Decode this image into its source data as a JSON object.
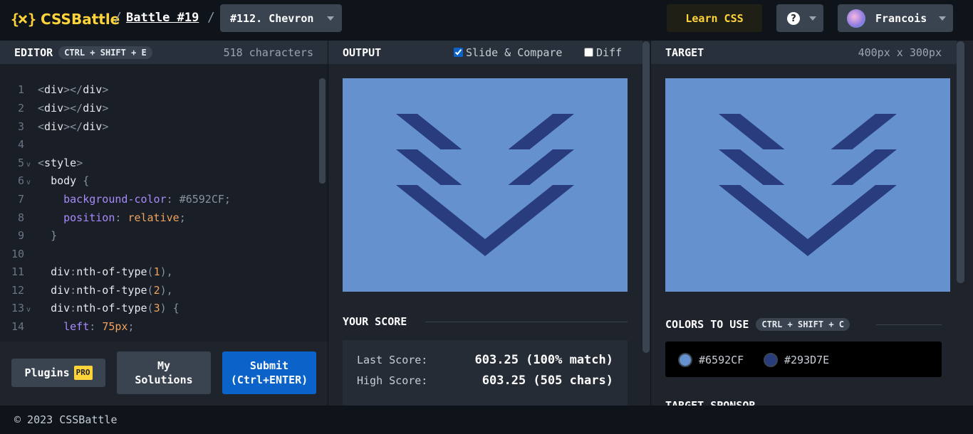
{
  "header": {
    "logo_text": "CSSBattle",
    "separator": "/",
    "battle_link": "Battle #19",
    "level_select": "#112. Chevron",
    "learn_label": "Learn CSS",
    "help_symbol": "?",
    "user_name": "Francois"
  },
  "editor": {
    "title": "EDITOR",
    "shortcut": "CTRL + SHIFT + E",
    "char_count": "518 characters",
    "lines": [
      {
        "n": "1",
        "code": "<div></div>"
      },
      {
        "n": "2",
        "code": "<div></div>"
      },
      {
        "n": "3",
        "code": "<div></div>"
      },
      {
        "n": "4",
        "code": ""
      },
      {
        "n": "5",
        "code": "<style>"
      },
      {
        "n": "6",
        "code": "  body {"
      },
      {
        "n": "7",
        "code": "    background-color: #6592CF;"
      },
      {
        "n": "8",
        "code": "    position: relative;"
      },
      {
        "n": "9",
        "code": "  }"
      },
      {
        "n": "10",
        "code": ""
      },
      {
        "n": "11",
        "code": "  div:nth-of-type(1),"
      },
      {
        "n": "12",
        "code": "  div:nth-of-type(2),"
      },
      {
        "n": "13",
        "code": "  div:nth-of-type(3) {"
      },
      {
        "n": "14",
        "code": "    left: 75px;"
      }
    ],
    "plugins_label": "Plugins",
    "pro_badge": "PRO",
    "my_solutions_label": "My Solutions",
    "submit_label": "Submit (Ctrl+ENTER)"
  },
  "output": {
    "title": "OUTPUT",
    "slide_compare_label": "Slide & Compare",
    "slide_compare_checked": true,
    "diff_label": "Diff",
    "diff_checked": false,
    "your_score_title": "YOUR SCORE",
    "last_score_label": "Last Score:",
    "last_score_value": "603.25 (100% match)",
    "high_score_label": "High Score:",
    "high_score_value": "603.25 (505 chars)"
  },
  "target": {
    "title": "TARGET",
    "size": "400px x 300px",
    "colors_title": "COLORS TO USE",
    "colors_shortcut": "CTRL + SHIFT + C",
    "colors": [
      {
        "hex": "#6592CF",
        "label": "#6592CF"
      },
      {
        "hex": "#293D7E",
        "label": "#293D7E"
      }
    ],
    "sponsor_title": "TARGET SPONSOR"
  },
  "palette": {
    "background": "#6592CF",
    "chevron": "#293D7E",
    "accent_yellow": "#ffd43b",
    "submit_blue": "#0b63c9"
  },
  "footer": {
    "copyright": "© 2023 CSSBattle"
  }
}
